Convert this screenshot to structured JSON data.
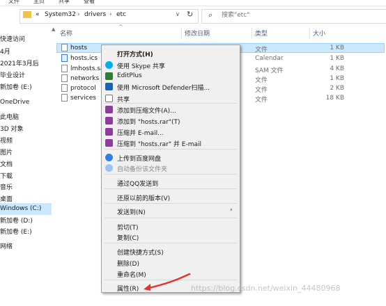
{
  "ribbon": {
    "tabs": [
      "文件",
      "主页",
      "共享",
      "查看"
    ]
  },
  "address": {
    "overflow": "«",
    "crumbs": [
      "System32",
      "drivers",
      "etc"
    ],
    "separator": "›"
  },
  "search": {
    "placeholder": "搜索\"etc\""
  },
  "nav": {
    "items": [
      "快速访问",
      "4月",
      "2021年3月后",
      "毕业设计",
      "新加卷 (E:)",
      "OneDrive",
      "此电脑",
      "3D 对象",
      "视频",
      "图片",
      "文档",
      "下载",
      "音乐",
      "桌面",
      "Windows (C:)",
      "新加卷 (D:)",
      "新加卷 (E:)",
      "网络"
    ],
    "selected": "Windows (C:)"
  },
  "columns": {
    "name": "名称",
    "modified": "修改日期",
    "type": "类型",
    "size": "大小"
  },
  "files": [
    {
      "name": "hosts",
      "type": "文件",
      "size": "1 KB"
    },
    {
      "name": "hosts.ics",
      "type": "Calendar",
      "size": "1 KB"
    },
    {
      "name": "lmhosts.sam",
      "type": "SAM 文件",
      "size": "4 KB"
    },
    {
      "name": "networks",
      "type": "文件",
      "size": "1 KB"
    },
    {
      "name": "protocol",
      "type": "文件",
      "size": "2 KB"
    },
    {
      "name": "services",
      "type": "文件",
      "size": "18 KB"
    }
  ],
  "context_menu": {
    "open_with": "打开方式(H)",
    "skype_share": "使用 Skype 共享",
    "editplus": "EditPlus",
    "defender": "使用 Microsoft Defender扫描...",
    "share": "共享",
    "add_archive": "添加到压缩文件(A)...",
    "add_hosts_rar": "添加到 \"hosts.rar\"(T)",
    "compress_email": "压缩并 E-mail...",
    "compress_rar_email": "压缩到 \"hosts.rar\" 并 E-mail",
    "upload_baidu": "上传到百度网盘",
    "auto_backup": "自动备份该文件夹",
    "send_qq": "通过QQ发送到",
    "restore": "还原以前的版本(V)",
    "send_to": "发送到(N)",
    "cut": "剪切(T)",
    "copy": "复制(C)",
    "create_shortcut": "创建快捷方式(S)",
    "delete": "删除(D)",
    "rename": "重命名(M)",
    "properties": "属性(R)"
  },
  "watermark": "https://blog.csdn.net/weixin_44480968",
  "colors": {
    "selection": "#cce8ff",
    "folder": "#f2c24e",
    "annotation_arrow": "#e8322d"
  }
}
